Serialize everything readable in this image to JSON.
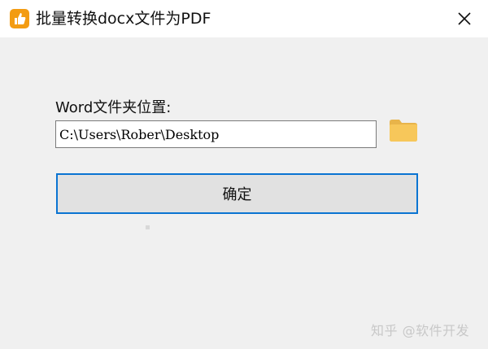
{
  "window": {
    "title": "批量转换docx文件为PDF",
    "app_icon": "thumbs-up-icon",
    "close_icon": "close-icon"
  },
  "form": {
    "label": "Word文件夹位置:",
    "path_value": "C:\\Users\\Rober\\Desktop",
    "folder_icon": "folder-icon"
  },
  "actions": {
    "confirm_label": "确定"
  },
  "watermark": {
    "text": "知乎 @软件开发"
  },
  "colors": {
    "accent": "#0a74d2",
    "icon_orange": "#f39c12",
    "folder_yellow": "#f7c75a"
  }
}
